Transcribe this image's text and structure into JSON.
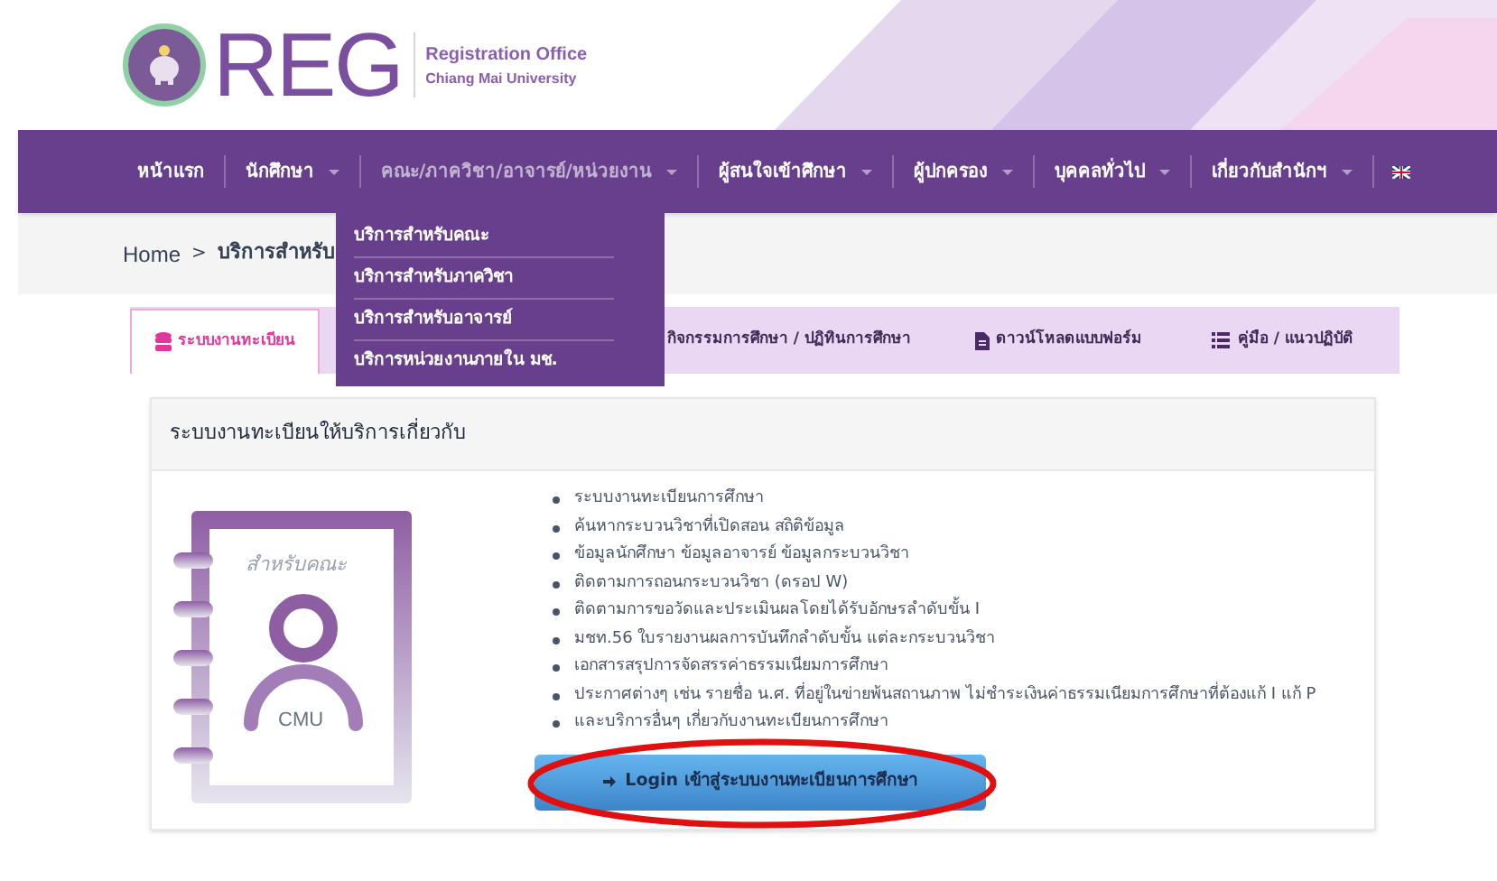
{
  "header": {
    "logo_text": "REG",
    "title": "Registration Office",
    "subtitle": "Chiang Mai University"
  },
  "nav": [
    {
      "label": "หน้าแรก",
      "kind": "link",
      "expanded": false
    },
    {
      "label": "นักศึกษา",
      "kind": "dropdown",
      "expanded": false
    },
    {
      "label": "คณะ/ภาควิชา/อาจารย์/หน่วยงาน",
      "kind": "dropdown",
      "expanded": true
    },
    {
      "label": "ผู้สนใจเข้าศึกษา",
      "kind": "dropdown",
      "expanded": false
    },
    {
      "label": "ผู้ปกครอง",
      "kind": "dropdown",
      "expanded": false
    },
    {
      "label": "บุคคลทั่วไป",
      "kind": "dropdown",
      "expanded": false
    },
    {
      "label": "เกี่ยวกับสำนักฯ",
      "kind": "dropdown",
      "expanded": false
    },
    {
      "kind": "flag"
    }
  ],
  "dropdown": [
    "บริการสำหรับคณะ",
    "บริการสำหรับภาควิชา",
    "บริการสำหรับอาจารย์",
    "บริการหน่วยงานภายใน มช."
  ],
  "breadcrumb": [
    "Home",
    ">",
    "บริการสำหรับ"
  ],
  "tabs": [
    {
      "label": "ระบบงานทะเบียน",
      "selected": true
    },
    {
      "label": "กิจกรรมการศึกษา / ปฏิทินการศึกษา",
      "selected": false
    },
    {
      "label": "ดาวน์โหลดแบบฟอร์ม",
      "selected": false
    },
    {
      "label": "คู่มือ / แนวปฏิบัติ",
      "selected": false
    }
  ],
  "card": {
    "title": "ระบบงานทะเบียนให้บริการเกี่ยวกับ",
    "illustration": {
      "caption": "สำหรับคณะ",
      "badge": "CMU"
    },
    "items": [
      "ระบบงานทะเบียนการศึกษา",
      "ค้นหากระบวนวิชาที่เปิดสอน สถิติข้อมูล",
      "ข้อมูลนักศึกษา ข้อมูลอาจารย์ ข้อมูลกระบวนวิชา",
      "ติดตามการถอนกระบวนวิชา (ดรอป W)",
      "ติดตามการขอวัดและประเมินผลโดยได้รับอักษรลำดับขั้น I",
      "มชท.56 ใบรายงานผลการบันทึกลำดับขั้น แต่ละกระบวนวิชา",
      "เอกสารสรุปการจัดสรรค่าธรรมเนียมการศึกษา",
      "ประกาศต่างๆ เช่น รายชื่อ น.ศ. ที่อยู่ในข่ายพ้นสถานภาพ ไม่ชำระเงินค่าธรรมเนียมการศึกษาที่ต้องแก้ I แก้ P",
      "และบริการอื่นๆ เกี่ยวกับงานทะเบียนการศึกษา"
    ],
    "login_button": "Login เข้าสู่ระบบงานทะเบียนการศึกษา",
    "highlighted": true
  }
}
